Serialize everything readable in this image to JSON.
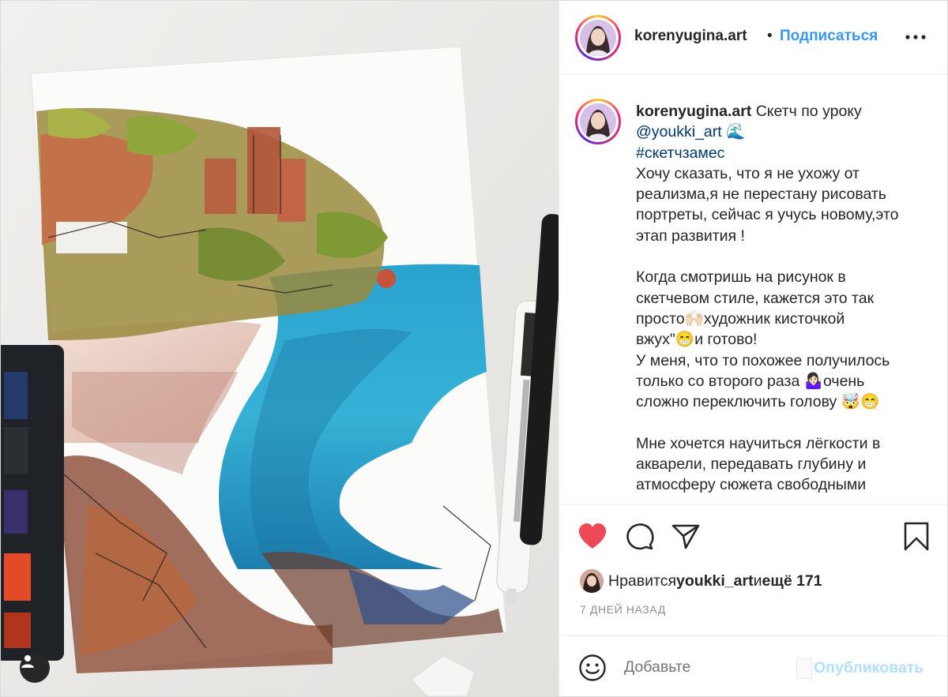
{
  "post": {
    "username": "korenyugina.art",
    "separator": "•",
    "follow_label": "Подписаться",
    "more_icon": "more-horizontal-icon"
  },
  "caption": {
    "username": "korenyugina.art",
    "lines": [
      " Скетч по уроку",
      "@youkki_art 🌊",
      "#скетчзамес",
      "Хочу сказать, что я не ухожу от",
      "реализма,я не перестану рисовать",
      "портреты, сейчас я учусь новому,это",
      "этап развития !",
      "",
      "Когда смотришь на рисунок в",
      "скетчевом стиле, кажется это так",
      "просто🙌🏻художник кисточкой",
      "вжух\"😁и готово!",
      "У меня, что то похожее получилось",
      "только со второго раза 🤷🏻‍♀️очень",
      "сложно переключить голову 🤯😁",
      "",
      "Мне хочется научиться лёгкости в",
      "акварели, передавать глубину и",
      "атмосферу сюжета свободными"
    ]
  },
  "actions": {
    "like_icon": "heart-filled-icon",
    "comment_icon": "comment-icon",
    "share_icon": "share-icon",
    "save_icon": "bookmark-icon",
    "like_color": "#ed4956"
  },
  "likes": {
    "prefix": "Нравится ",
    "liked_by": "youkki_art",
    "middle": " и ",
    "others": "ещё 171"
  },
  "time_ago": "7 ДНЕЙ НАЗАД",
  "comment": {
    "placeholder": "Добавьте",
    "publish_label": "Опубликовать"
  },
  "colors": {
    "accent": "#3897f0",
    "link": "#00376b",
    "muted": "#8e8e8e",
    "publish_disabled": "#b2dffc"
  }
}
